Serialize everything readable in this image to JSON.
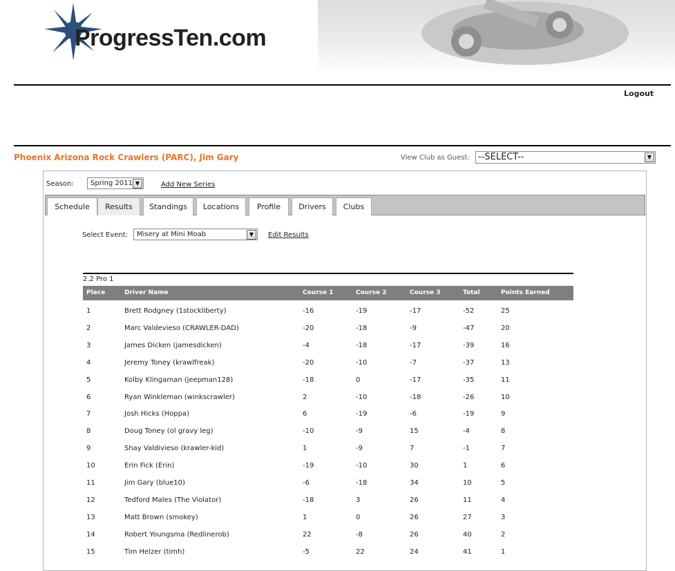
{
  "site": {
    "logo_text": "ProgressTen.com"
  },
  "header": {
    "logout_label": "Logout"
  },
  "club": {
    "title": "Phoenix Arizona Rock Crawlers (PARC), Jim Gary"
  },
  "guest": {
    "label": "View Club as Guest:",
    "selected": "--SELECT--"
  },
  "season": {
    "label": "Season:",
    "selected": "Spring 2011",
    "add_series_label": "Add New Series"
  },
  "tabs": [
    {
      "label": "Schedule"
    },
    {
      "label": "Results"
    },
    {
      "label": "Standings"
    },
    {
      "label": "Locations"
    },
    {
      "label": "Profile"
    },
    {
      "label": "Drivers"
    },
    {
      "label": "Clubs"
    }
  ],
  "active_tab": "Results",
  "event": {
    "label": "Select Event:",
    "selected": "Misery at Mini Moab",
    "edit_label": "Edit Results"
  },
  "results": {
    "class_name": "2.2 Pro 1",
    "columns": [
      "Place",
      "Driver Name",
      "Course 1",
      "Course 2",
      "Course 3",
      "Total",
      "Points Earned"
    ],
    "rows": [
      [
        "1",
        "Brett Rodgney (1stockliberty)",
        "-16",
        "-19",
        "-17",
        "-52",
        "25"
      ],
      [
        "2",
        "Marc Valdevieso (CRAWLER-DAD)",
        "-20",
        "-18",
        "-9",
        "-47",
        "20"
      ],
      [
        "3",
        "James Dicken (jamesdicken)",
        "-4",
        "-18",
        "-17",
        "-39",
        "16"
      ],
      [
        "4",
        "Jeremy Toney (krawlfreak)",
        "-20",
        "-10",
        "-7",
        "-37",
        "13"
      ],
      [
        "5",
        "Kolby Klingaman (jeepman128)",
        "-18",
        "0",
        "-17",
        "-35",
        "11"
      ],
      [
        "6",
        "Ryan Winkleman (winkscrawler)",
        "2",
        "-10",
        "-18",
        "-26",
        "10"
      ],
      [
        "7",
        "Josh Hicks (Hoppa)",
        "6",
        "-19",
        "-6",
        "-19",
        "9"
      ],
      [
        "8",
        "Doug Toney (ol gravy leg)",
        "-10",
        "-9",
        "15",
        "-4",
        "8"
      ],
      [
        "9",
        "Shay Valdivieso (krawler-kid)",
        "1",
        "-9",
        "7",
        "-1",
        "7"
      ],
      [
        "10",
        "Erin Fick (Erin)",
        "-19",
        "-10",
        "30",
        "1",
        "6"
      ],
      [
        "11",
        "Jim Gary (blue10)",
        "-6",
        "-18",
        "34",
        "10",
        "5"
      ],
      [
        "12",
        "Tedford Males (The Violator)",
        "-18",
        "3",
        "26",
        "11",
        "4"
      ],
      [
        "13",
        "Matt Brown (smokey)",
        "1",
        "0",
        "26",
        "27",
        "3"
      ],
      [
        "14",
        "Robert Youngsma (Redlinerob)",
        "22",
        "-8",
        "26",
        "40",
        "2"
      ],
      [
        "15",
        "Tim Helzer (timh)",
        "-5",
        "22",
        "24",
        "41",
        "1"
      ]
    ]
  }
}
